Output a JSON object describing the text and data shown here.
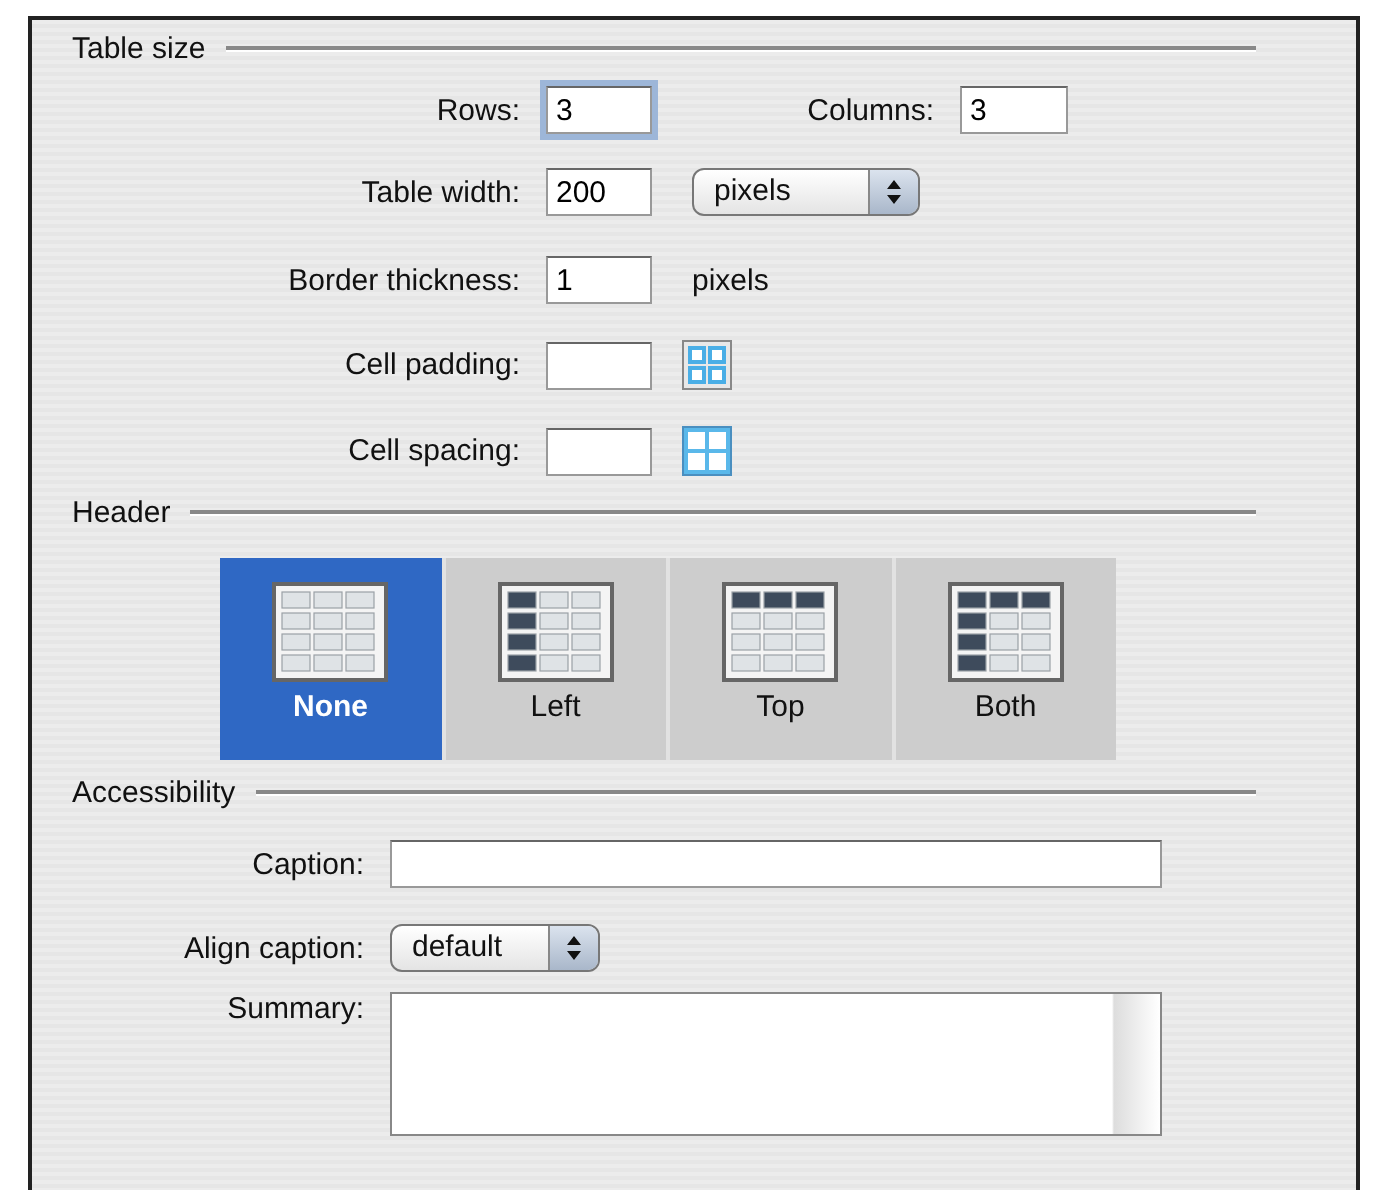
{
  "table_size": {
    "title": "Table size",
    "rows": {
      "label": "Rows:",
      "value": "3",
      "focused": true
    },
    "columns": {
      "label": "Columns:",
      "value": "3",
      "focused": false
    },
    "table_width": {
      "label": "Table width:",
      "value": "200",
      "unit": "pixels"
    },
    "border_thickness": {
      "label": "Border thickness:",
      "value": "1",
      "unit": "pixels"
    },
    "cell_padding": {
      "label": "Cell padding:"
    },
    "cell_spacing": {
      "label": "Cell spacing:"
    }
  },
  "header": {
    "title": "Header",
    "options": [
      {
        "label": "None",
        "kind": "none",
        "selected": true
      },
      {
        "label": "Left",
        "kind": "left",
        "selected": false
      },
      {
        "label": "Top",
        "kind": "top",
        "selected": false
      },
      {
        "label": "Both",
        "kind": "both",
        "selected": false
      }
    ]
  },
  "accessibility": {
    "title": "Accessibility",
    "caption": {
      "label": "Caption:"
    },
    "align_caption": {
      "label": "Align caption:",
      "value": "default"
    },
    "summary": {
      "label": "Summary:"
    }
  }
}
